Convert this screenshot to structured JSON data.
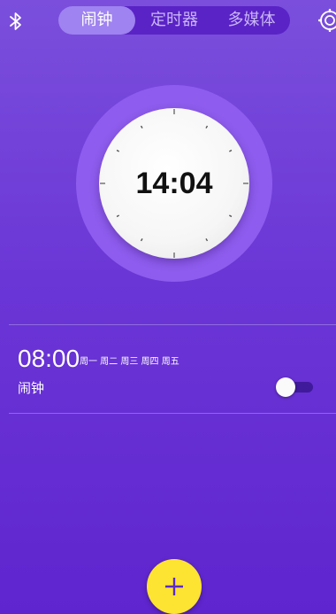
{
  "header": {
    "tabs": [
      {
        "label": "闹钟",
        "active": true
      },
      {
        "label": "定时器",
        "active": false
      },
      {
        "label": "多媒体",
        "active": false
      }
    ],
    "left_icon": "bluetooth-icon",
    "right_icon": "gear-icon"
  },
  "clock": {
    "time": "14:04"
  },
  "alarms": [
    {
      "time": "08:00",
      "days": "周一 周二 周三 周四 周五",
      "label": "闹钟",
      "enabled": false
    }
  ],
  "fab": {
    "icon": "plus-icon",
    "color": "#fde332"
  },
  "colors": {
    "background_top": "#7b4fdc",
    "background_bottom": "#5f25cf",
    "accent": "#9f83f0"
  }
}
